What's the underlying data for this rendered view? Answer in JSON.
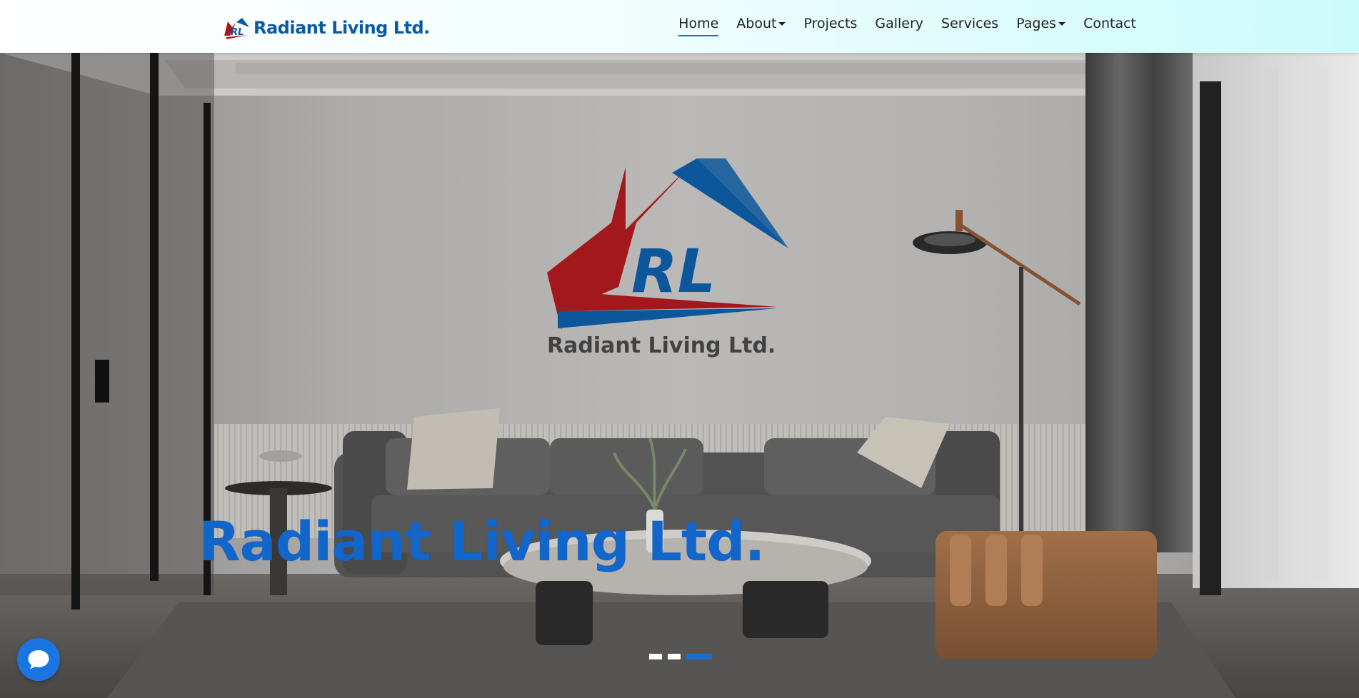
{
  "brand": {
    "name": "Radiant Living Ltd.",
    "logo_icon": "rl-house-logo-icon"
  },
  "nav": {
    "items": [
      {
        "label": "Home",
        "active": true,
        "dropdown": false
      },
      {
        "label": "About",
        "active": false,
        "dropdown": true
      },
      {
        "label": "Projects",
        "active": false,
        "dropdown": false
      },
      {
        "label": "Gallery",
        "active": false,
        "dropdown": false
      },
      {
        "label": "Services",
        "active": false,
        "dropdown": false
      },
      {
        "label": "Pages",
        "active": false,
        "dropdown": true
      },
      {
        "label": "Contact",
        "active": false,
        "dropdown": false
      }
    ]
  },
  "hero": {
    "title": "Radiant Living Ltd.",
    "wall_logo_text": "Radiant Living Ltd.",
    "wall_logo_monogram": "RL",
    "slides": 3,
    "active_slide": 3
  },
  "chat": {
    "icon": "chat-bubble-icon"
  },
  "colors": {
    "brand_blue": "#0c5aa2",
    "brand_red": "#a8181e",
    "accent": "#1a6fd0",
    "hero_title": "#1265c9"
  }
}
